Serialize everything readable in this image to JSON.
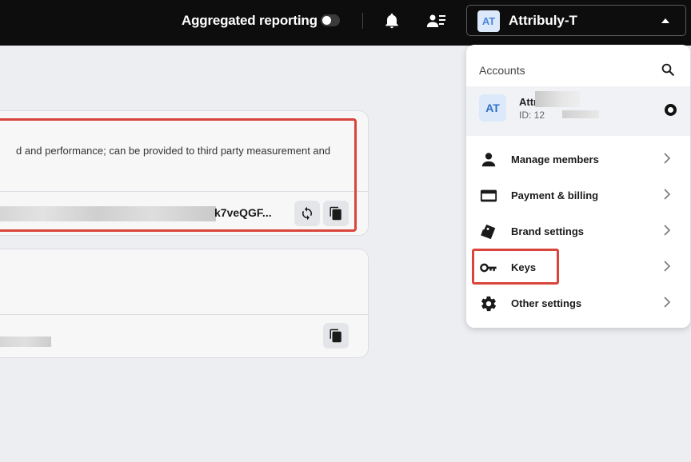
{
  "topbar": {
    "aggregated_label": "Aggregated reporting",
    "account_initials": "AT",
    "account_name": "Attribuly-T"
  },
  "main": {
    "card1": {
      "description": "d and performance; can be provided to third party measurement and",
      "key_value": "k7veQGF..."
    }
  },
  "dropdown": {
    "heading": "Accounts",
    "account": {
      "initials": "AT",
      "name": "Attr",
      "id_prefix": "ID: 12"
    },
    "items": [
      {
        "label": "Manage members",
        "icon": "person-icon"
      },
      {
        "label": "Payment & billing",
        "icon": "credit-card-icon"
      },
      {
        "label": "Brand settings",
        "icon": "brand-tag-icon"
      },
      {
        "label": "Keys",
        "icon": "key-icon"
      },
      {
        "label": "Other settings",
        "icon": "gear-icon"
      }
    ]
  },
  "colors": {
    "topbar_bg": "#0d0d0d",
    "page_bg": "#eceef2",
    "highlight": "#d9453b",
    "avatar_bg": "#dbe9fb"
  }
}
